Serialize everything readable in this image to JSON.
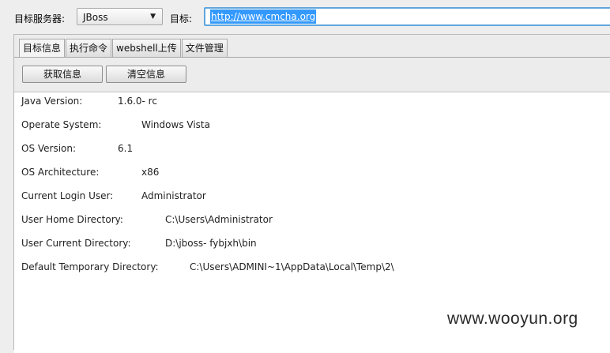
{
  "header": {
    "server_label": "目标服务器:",
    "server_value": "JBoss",
    "target_label": "目标:",
    "target_url": "http://www.cmcha.org"
  },
  "tabs": [
    {
      "label": "目标信息",
      "active": true
    },
    {
      "label": "执行命令",
      "active": false
    },
    {
      "label": "webshell上传",
      "active": false
    },
    {
      "label": "文件管理",
      "active": false
    }
  ],
  "buttons": {
    "fetch": "获取信息",
    "clear": "清空信息"
  },
  "info": [
    {
      "label": "Java Version:",
      "value": "1.6.0- rc"
    },
    {
      "label": "Operate System:",
      "value": "Windows Vista"
    },
    {
      "label": "OS Version:",
      "value": "6.1"
    },
    {
      "label": "OS Architecture:",
      "value": "x86"
    },
    {
      "label": "Current Login User:",
      "value": "Administrator"
    },
    {
      "label": "User Home Directory:",
      "value": "C:\\Users\\Administrator"
    },
    {
      "label": "User Current Directory:",
      "value": "D:\\jboss- fybjxh\\bin"
    },
    {
      "label": "Default Temporary Directory:",
      "value": "C:\\Users\\ADMINI~1\\AppData\\Local\\Temp\\2\\"
    }
  ],
  "watermark": "www.wooyun.org",
  "colors": {
    "selection": "#3399ff",
    "input_focus": "#5fa6de"
  }
}
